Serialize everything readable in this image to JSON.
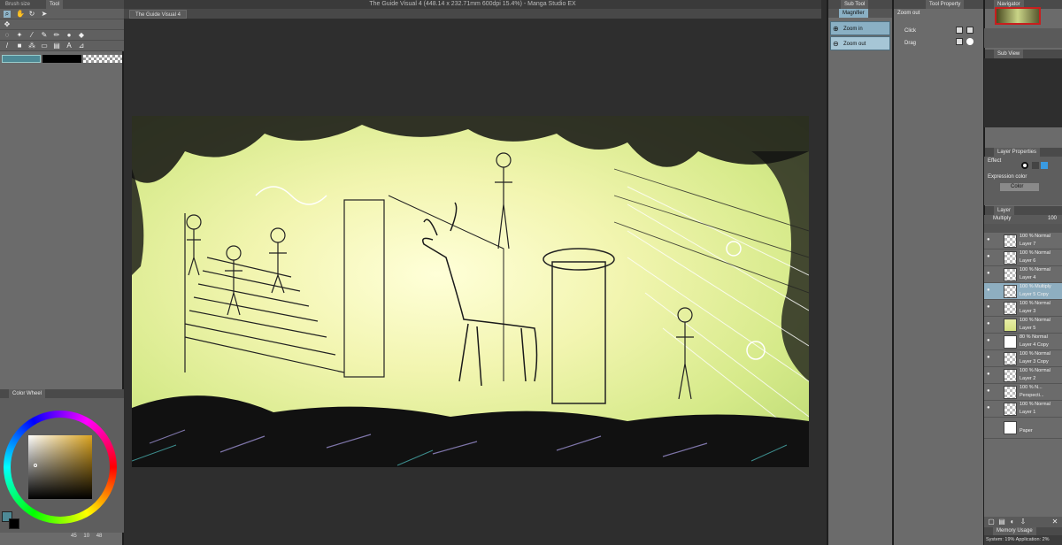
{
  "window": {
    "title": "The Guide Visual 4 (448.14 x 232.71mm 600dpi 15.4%) - Manga Studio EX",
    "document_tab": "The Guide Visual 4"
  },
  "left_panel": {
    "tabs": [
      "Brush size",
      "Tool"
    ],
    "color_wheel_tab": "Color Wheel",
    "hsv": {
      "h": "45",
      "s": "10",
      "v": "48"
    }
  },
  "sub_tool": {
    "tab": "Sub Tool",
    "group_tab": "Magnifier",
    "items": [
      "Zoom in",
      "Zoom out"
    ],
    "selected": "Zoom out"
  },
  "tool_property": {
    "tab": "Tool Property",
    "header": "Zoom out",
    "rows": [
      "Click",
      "Drag"
    ]
  },
  "right_panel": {
    "navigator_tab": "Navigator",
    "subview_tab": "Sub View",
    "layer_properties_tab": "Layer Properties",
    "effect_label": "Effect",
    "expression_label": "Expression color",
    "expression_value": "Color",
    "layer_tab": "Layer",
    "blend_mode": "Multiply",
    "opacity": "100",
    "layers": [
      {
        "mode": "100 % Normal",
        "name": "Layer 7",
        "selected": false
      },
      {
        "mode": "100 % Normal",
        "name": "Layer 6",
        "selected": false
      },
      {
        "mode": "100 % Normal",
        "name": "Layer 4",
        "selected": false
      },
      {
        "mode": "100 % Multiply",
        "name": "Layer 5 Copy",
        "selected": true
      },
      {
        "mode": "100 % Normal",
        "name": "Layer 3",
        "selected": false
      },
      {
        "mode": "100 % Normal",
        "name": "Layer 5",
        "selected": false
      },
      {
        "mode": "80 % Normal",
        "name": "Layer 4 Copy",
        "selected": false
      },
      {
        "mode": "100 % Normal",
        "name": "Layer 3 Copy",
        "selected": false
      },
      {
        "mode": "100 % Normal",
        "name": "Layer 2",
        "selected": false
      },
      {
        "mode": "100 % N...",
        "name": "Perspecti...",
        "selected": false
      },
      {
        "mode": "100 % Normal",
        "name": "Layer 1",
        "selected": false
      },
      {
        "mode": "",
        "name": "Paper",
        "selected": false
      }
    ],
    "memory_tab": "Memory Usage",
    "memory_text": "System: 19%  Application: 2%"
  },
  "colors": {
    "selection": "#8eaec0",
    "panel": "#6b6b6b",
    "workspace": "#2e2e2e",
    "foreground_swatch": "#4e8a96"
  }
}
